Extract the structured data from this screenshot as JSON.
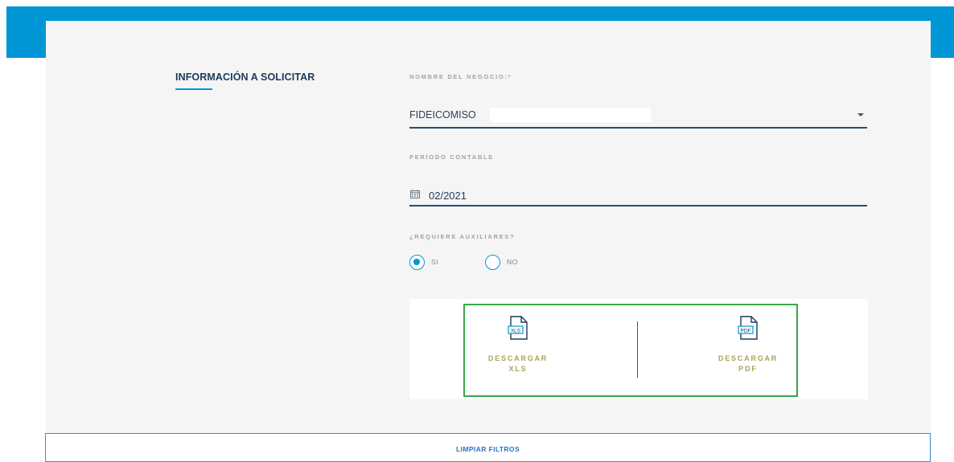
{
  "form": {
    "section_title": "INFORMACIÓN A SOLICITAR",
    "business_name": {
      "label": "NOMBRE DEL NEGOCIO:*",
      "value": "FIDEICOMISO"
    },
    "period": {
      "label": "PERÍODO CONTABLE",
      "value": "02/2021",
      "icon": "calendar-icon"
    },
    "auxiliaries": {
      "label": "¿REQUIERE AUXILIARES?",
      "options": [
        {
          "label": "SI",
          "selected": true
        },
        {
          "label": "NO",
          "selected": false
        }
      ]
    }
  },
  "downloads": {
    "xls": {
      "line1": "DESCARGAR",
      "line2": "XLS",
      "icon_text": "XLS",
      "icon": "xls-file-icon"
    },
    "pdf": {
      "line1": "DESCARGAR",
      "line2": "PDF",
      "icon_text": "PDF",
      "icon": "pdf-file-icon"
    }
  },
  "actions": {
    "clear_label": "LIMPIAR FILTROS"
  },
  "colors": {
    "brand_blue": "#0096d6",
    "navy": "#1b3a5c",
    "download_text": "#a7a35a",
    "highlight_green": "#35a846",
    "clear_blue": "#2574c4"
  }
}
